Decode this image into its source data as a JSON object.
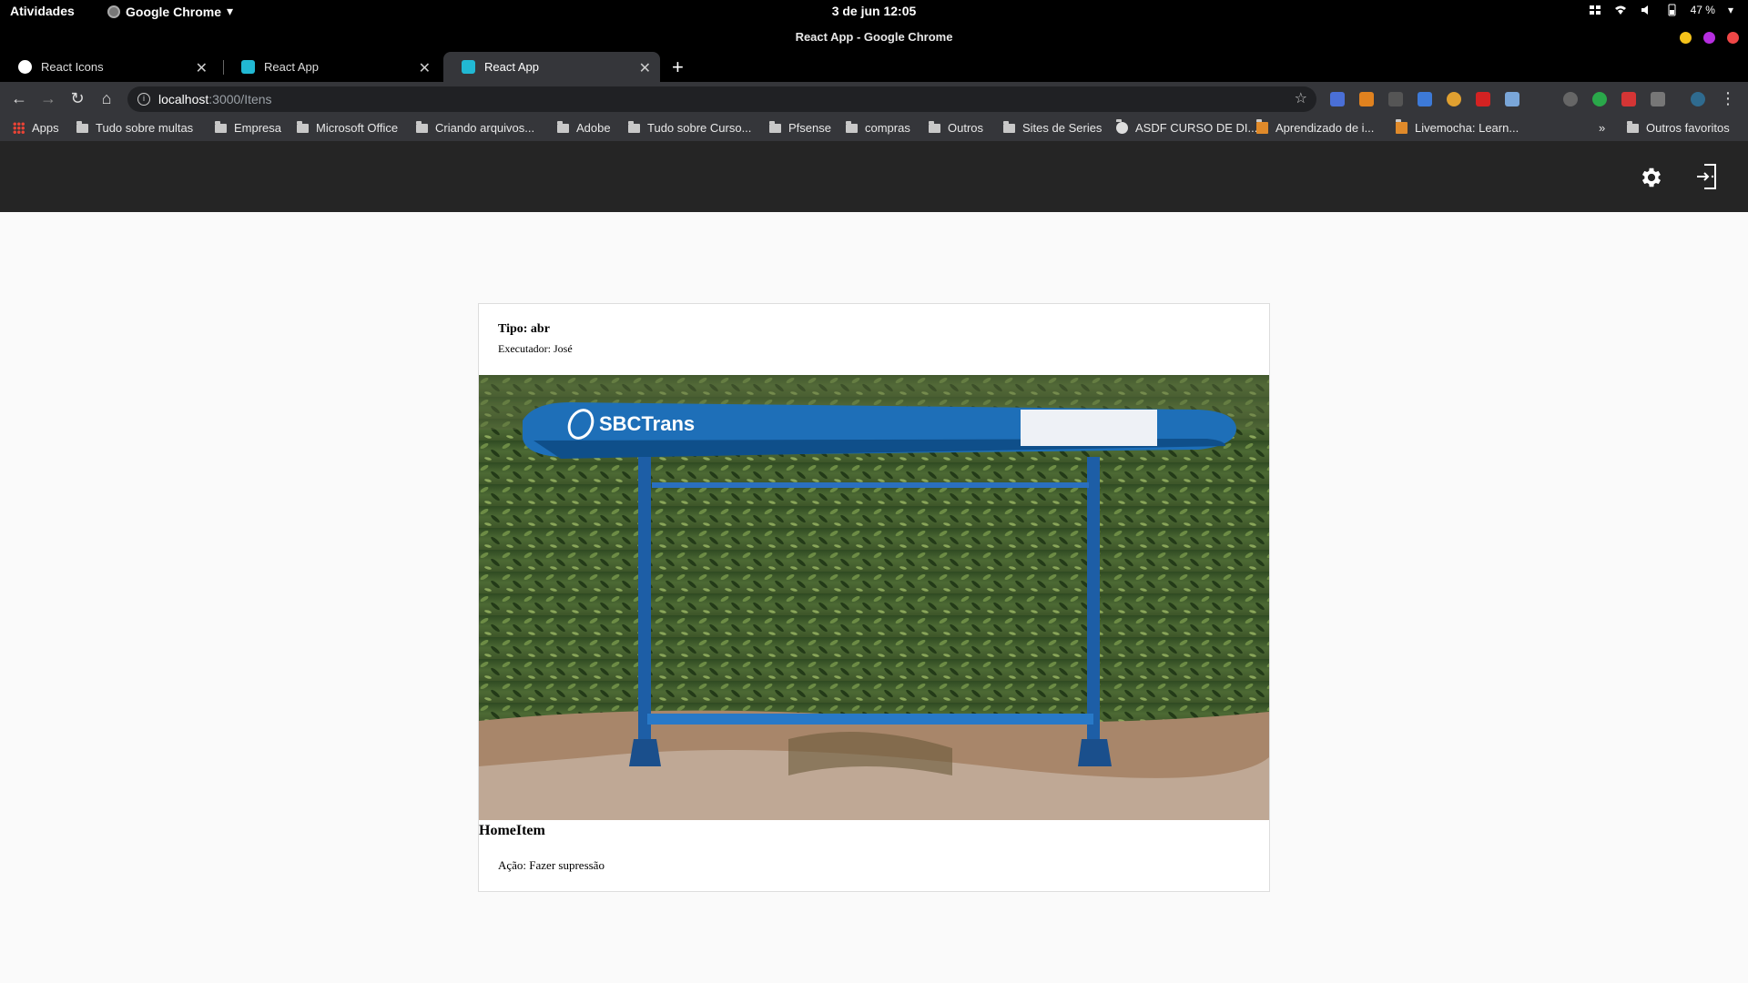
{
  "system": {
    "activities": "Atividades",
    "app_menu": "Google Chrome",
    "clock": "3 de jun  12:05",
    "battery": "47 %"
  },
  "window": {
    "title": "React App - Google Chrome"
  },
  "tabs": [
    {
      "label": "React Icons",
      "active": false
    },
    {
      "label": "React App",
      "active": false
    },
    {
      "label": "React App",
      "active": true
    }
  ],
  "address": {
    "host": "localhost",
    "path": ":3000/Itens"
  },
  "bookmarks": [
    "Apps",
    "Tudo sobre multas",
    "Empresa",
    "Microsoft Office",
    "Criando arquivos...",
    "Adobe",
    "Tudo sobre Curso...",
    "Pfsense",
    "compras",
    "Outros",
    "Sites de Series",
    "ASDF CURSO DE DI...",
    "Aprendizado de i...",
    "Livemocha: Learn..."
  ],
  "bookmarks_more": "»",
  "bookmarks_other": "Outros favoritos",
  "card": {
    "tipo": "Tipo: abr",
    "executor": "Executador: José",
    "photo_brand": "SBCTrans",
    "title": "HomeItem",
    "acao": "Ação: Fazer supressão"
  },
  "colors": {
    "app_header": "#252525",
    "page_bg": "#fafafa",
    "shelter_blue": "#1e6fb8"
  }
}
